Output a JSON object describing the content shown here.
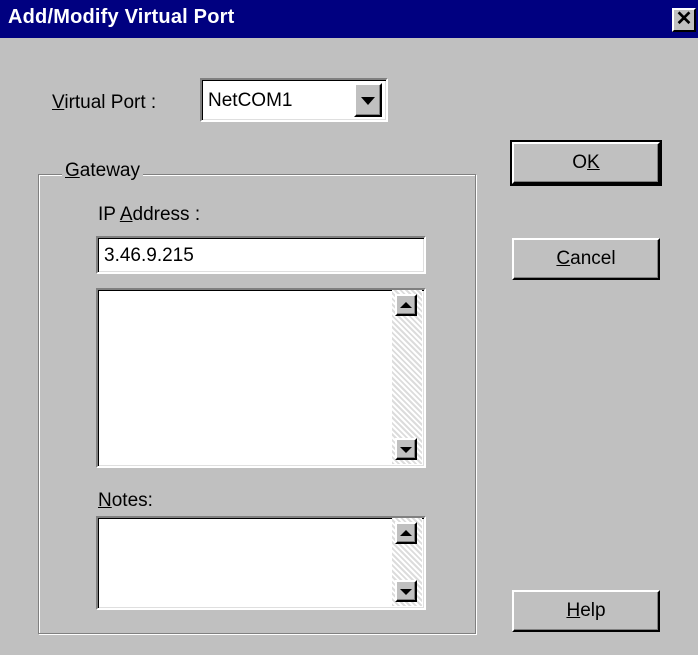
{
  "window": {
    "title": "Add/Modify Virtual Port",
    "close_glyph": "✕"
  },
  "virtual_port": {
    "label_prefix": "",
    "label_mnemonic": "V",
    "label_rest": "irtual Port :",
    "selected": "NetCOM1"
  },
  "gateway": {
    "legend_mnemonic": "G",
    "legend_rest": "ateway",
    "ip_label_prefix": "IP ",
    "ip_label_mnemonic": "A",
    "ip_label_rest": "ddress :",
    "ip_value": "3.46.9.215",
    "notes_label_mnemonic": "N",
    "notes_label_rest": "otes:"
  },
  "buttons": {
    "ok_prefix": "O",
    "ok_mnemonic": "K",
    "cancel_mnemonic": "C",
    "cancel_rest": "ancel",
    "help_mnemonic": "H",
    "help_rest": "elp"
  },
  "icons": {
    "close": "close-icon",
    "dropdown": "chevron-down-icon",
    "scroll_up": "scroll-up-arrow-icon",
    "scroll_down": "scroll-down-arrow-icon"
  }
}
